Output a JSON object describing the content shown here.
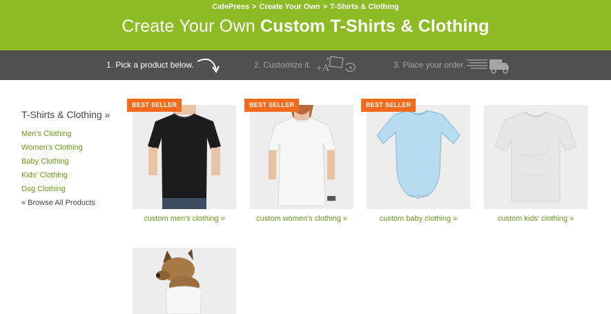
{
  "breadcrumb": {
    "items": [
      "CafePress",
      "Create Your Own",
      "T-Shirts & Clothing"
    ],
    "separator": ">"
  },
  "header": {
    "title_light": "Create Your Own",
    "title_bold": "Custom T-Shirts & Clothing"
  },
  "steps": [
    {
      "label": "1. Pick a product below.",
      "icon": "curved-arrow-icon"
    },
    {
      "label": "2. Customize it.",
      "icon": "customize-icon"
    },
    {
      "label": "3. Place your order.",
      "icon": "delivery-truck-icon"
    }
  ],
  "sidebar": {
    "heading": "T-Shirts & Clothing »",
    "links": [
      "Men's Clothing",
      "Women's Clothing",
      "Baby Clothing",
      "Kids' Clothing",
      "Dog Clothing"
    ],
    "browse_all": "« Browse All Products"
  },
  "products": [
    {
      "badge": "BEST SELLER",
      "link": "custom men's clothing »"
    },
    {
      "badge": "BEST SELLER",
      "link": "custom women's clothing »"
    },
    {
      "badge": "BEST SELLER",
      "link": "custom baby clothing »"
    },
    {
      "badge": "",
      "link": "custom kids' clothing »"
    },
    {
      "badge": "",
      "link": ""
    }
  ],
  "colors": {
    "header_green": "#8cbb23",
    "steps_bar": "#505050",
    "badge_orange": "#f26a1b",
    "link_green": "#6a9a1a"
  }
}
